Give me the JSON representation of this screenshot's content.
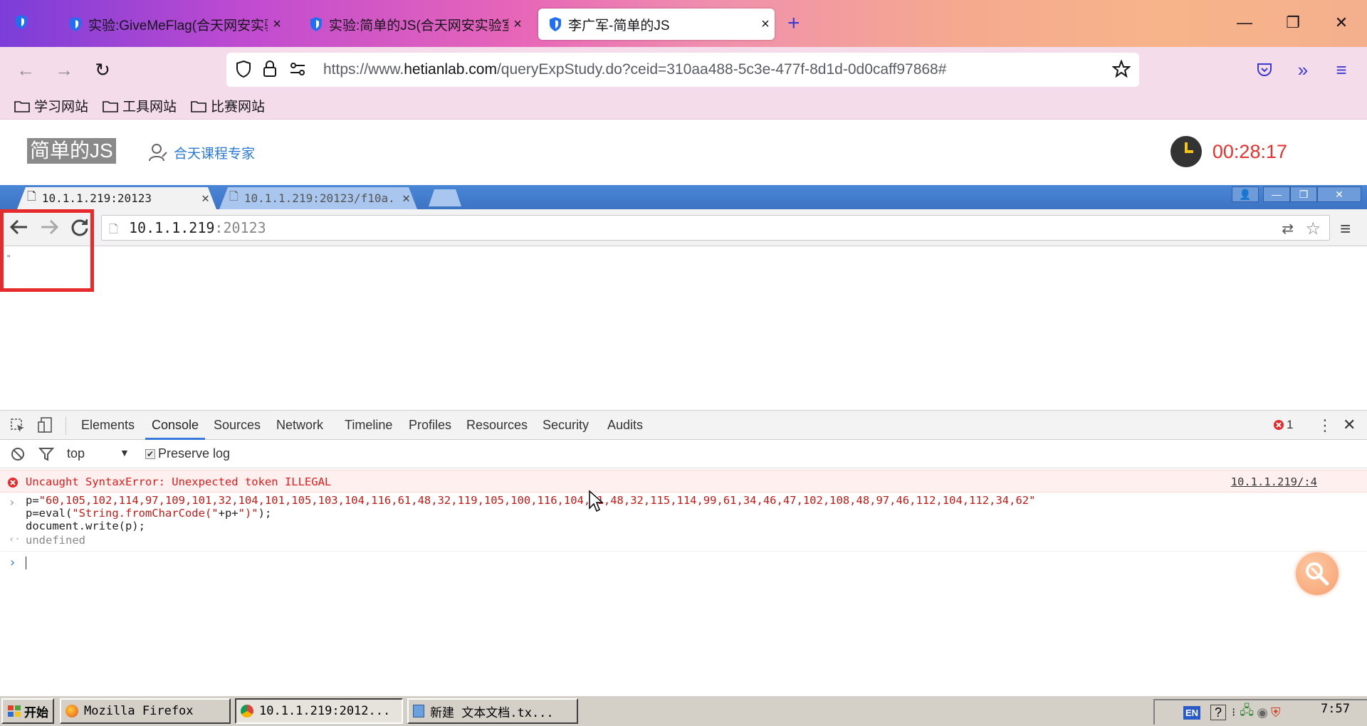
{
  "firefox": {
    "tabs": [
      {
        "title": "实验:GiveMeFlag(合天网安实验"
      },
      {
        "title": "实验:简单的JS(合天网安实验室)"
      },
      {
        "title": "李广军-简单的JS"
      }
    ],
    "url": {
      "base": "https://www.",
      "domain": "hetianlab.com",
      "path": "/queryExpStudy.do?ceid=310aa488-5c3e-477f-8d1d-0d0caff97868#"
    },
    "bookmarks": [
      "学习网站",
      "工具网站",
      "比赛网站"
    ]
  },
  "lab": {
    "title": "简单的JS",
    "expert": "合天课程专家",
    "timer": "00:28:17"
  },
  "chrome": {
    "tabs": [
      {
        "title": "10.1.1.219:20123"
      },
      {
        "title": "10.1.1.219:20123/f10a."
      }
    ],
    "omnibox": {
      "host": "10.1.1.219",
      "port": ":20123"
    },
    "page_text": "\""
  },
  "devtools": {
    "tabs": [
      "Elements",
      "Console",
      "Sources",
      "Network",
      "Timeline",
      "Profiles",
      "Resources",
      "Security",
      "Audits"
    ],
    "error_count": "1",
    "context": "top",
    "preserve_log": "Preserve log",
    "error": {
      "message": "Uncaught SyntaxError: Unexpected token ILLEGAL",
      "source": "10.1.1.219/:4"
    },
    "command": {
      "line1_prefix": "p=",
      "line1_string": "\"60,105,102,114,97,109,101,32,104,101,105,103,104,116,61,48,32,119,105,100,116,104,61,48,32,115,114,99,61,34,46,47,102,108,48,97,46,112,104,112,34,62\"",
      "line2_prefix": "p=eval(",
      "line2_string": "\"String.fromCharCode(\"",
      "line2_mid": "+p+",
      "line2_string2": "\")\"",
      "line2_suffix": ");",
      "line3": "document.write(p);"
    },
    "result": "undefined"
  },
  "taskbar": {
    "start": "开始",
    "items": [
      "Mozilla Firefox",
      "10.1.1.219:2012...",
      "新建 文本文档.tx..."
    ],
    "lang": "EN",
    "clock": "7:57"
  }
}
